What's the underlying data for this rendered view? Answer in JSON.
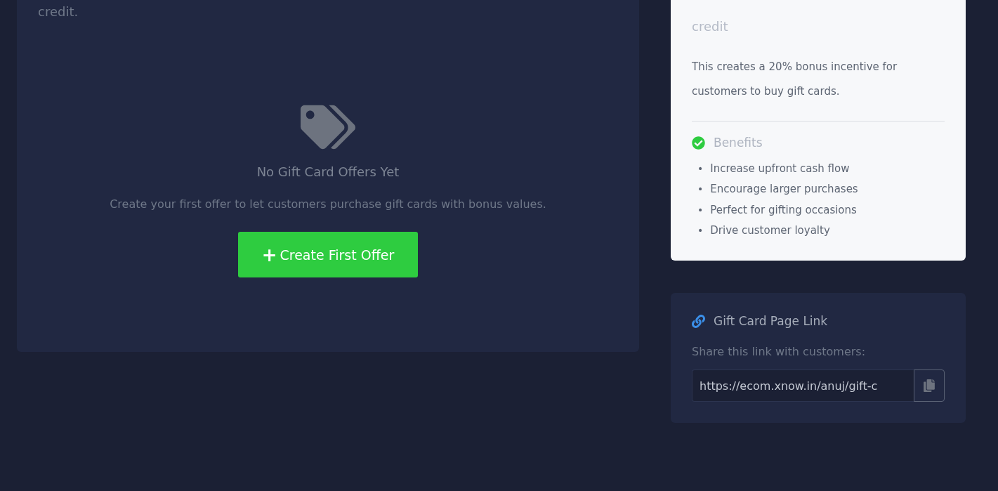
{
  "offers_panel": {
    "top_text": "credit.",
    "empty_state": {
      "title": "No Gift Card Offers Yet",
      "message": "Create your first offer to let customers purchase gift cards with bonus values.",
      "button": {
        "icon": "+",
        "label": "Create First Offer"
      }
    }
  },
  "example_card": {
    "example_tail": "credit",
    "explanation": "This creates a 20% bonus incentive for customers to buy gift cards.",
    "benefits": {
      "title": "Benefits",
      "items": [
        {
          "bullet": "•",
          "text": "Increase upfront cash flow"
        },
        {
          "bullet": "•",
          "text": "Encourage larger purchases"
        },
        {
          "bullet": "•",
          "text": "Perfect for gifting occasions"
        },
        {
          "bullet": "•",
          "text": "Drive customer loyalty"
        }
      ]
    }
  },
  "link_card": {
    "title": "Gift Card Page Link",
    "hint": "Share this link with customers:",
    "url": "https://ecom.xnow.in/anuj/gift-c"
  }
}
